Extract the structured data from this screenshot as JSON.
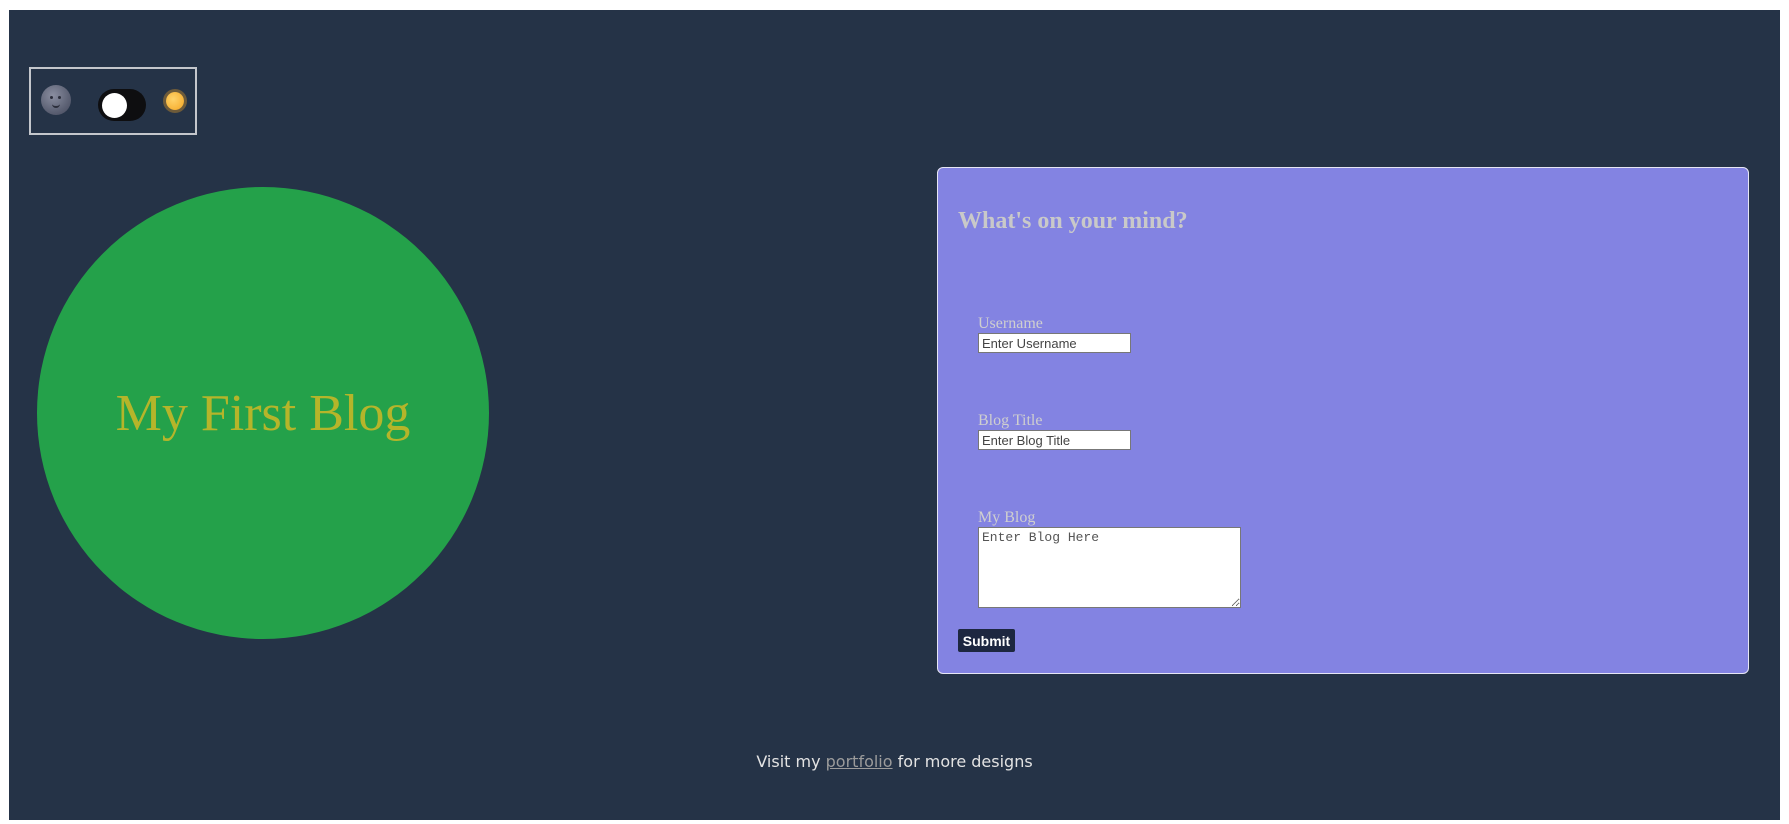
{
  "theme_toggle": {
    "left_icon": "moon-face-icon",
    "right_icon": "sun-face-icon",
    "state": "dark"
  },
  "hero": {
    "title": "My First Blog"
  },
  "form": {
    "heading": "What's on your mind?",
    "username": {
      "label": "Username",
      "placeholder": "Enter Username",
      "value": ""
    },
    "blog_title": {
      "label": "Blog Title",
      "placeholder": "Enter Blog Title",
      "value": ""
    },
    "blog_body": {
      "label": "My Blog",
      "placeholder": "Enter Blog Here",
      "value": ""
    },
    "submit_label": "Submit"
  },
  "footer": {
    "prefix": "Visit my",
    "link_text": "portfolio",
    "suffix": "for more designs"
  },
  "colors": {
    "page_background": "#253347",
    "hero_circle": "#24a14a",
    "hero_text": "#b5b52a",
    "form_card": "#8383e2",
    "submit_button": "#1d2740"
  }
}
